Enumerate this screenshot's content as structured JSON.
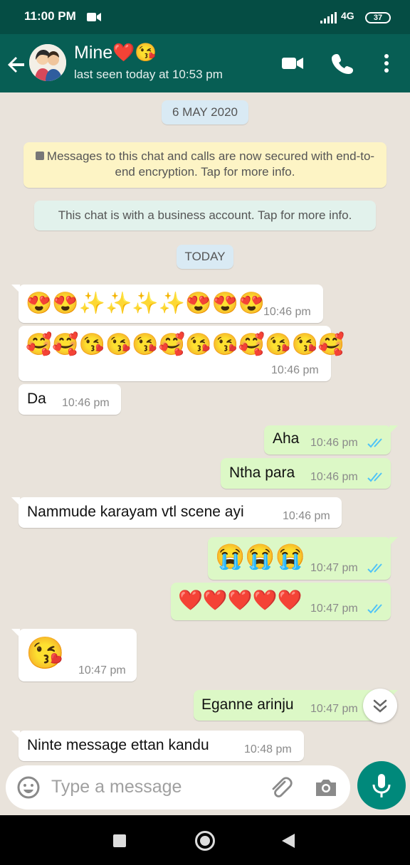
{
  "status_bar": {
    "time": "11:00 PM",
    "network": "4G",
    "battery": "37"
  },
  "header": {
    "contact_name": "Mine❤️😘",
    "last_seen": "last seen today at 10:53 pm",
    "icons": [
      "back-arrow-icon",
      "video-call-icon",
      "voice-call-icon",
      "more-options-icon"
    ]
  },
  "chat": {
    "date_chip": "6 MAY 2020",
    "encryption_notice": "Messages to this chat and calls are now secured with end-to-end encryption. Tap for more info.",
    "business_notice": "This chat is with a business account. Tap for more info.",
    "today_chip": "TODAY",
    "messages": [
      {
        "direction": "in",
        "emoji": "😍😍✨✨✨✨😍😍😍",
        "time": "10:46 pm"
      },
      {
        "direction": "in",
        "emoji": "🥰🥰😘😘😘🥰😘😘🥰😘😘🥰",
        "time": "10:46 pm"
      },
      {
        "direction": "in",
        "text": "Da",
        "time": "10:46 pm"
      },
      {
        "direction": "out",
        "text": "Aha",
        "time": "10:46 pm",
        "status": "read"
      },
      {
        "direction": "out",
        "text": "Ntha para",
        "time": "10:46 pm",
        "status": "read"
      },
      {
        "direction": "in",
        "text": "Nammude karayam vtl scene ayi",
        "time": "10:46 pm"
      },
      {
        "direction": "out",
        "emoji": "😭😭😭",
        "time": "10:47 pm",
        "status": "read"
      },
      {
        "direction": "out",
        "emoji": "❤️❤️❤️❤️❤️",
        "time": "10:47 pm",
        "status": "read"
      },
      {
        "direction": "in",
        "emoji": "😘",
        "time": "10:47 pm"
      },
      {
        "direction": "out",
        "text": "Eganne arinju",
        "time": "10:47 pm",
        "status": "read"
      },
      {
        "direction": "in",
        "text": "Ninte message ettan kandu",
        "time": "10:48 pm"
      }
    ]
  },
  "input": {
    "placeholder": "Type a message"
  },
  "colors": {
    "header": "#075e54",
    "status_bar": "#054d44",
    "outgoing_bubble": "#dcf8c6",
    "incoming_bubble": "#ffffff",
    "read_ticks": "#4fc3f7",
    "mic_button": "#00897b"
  }
}
